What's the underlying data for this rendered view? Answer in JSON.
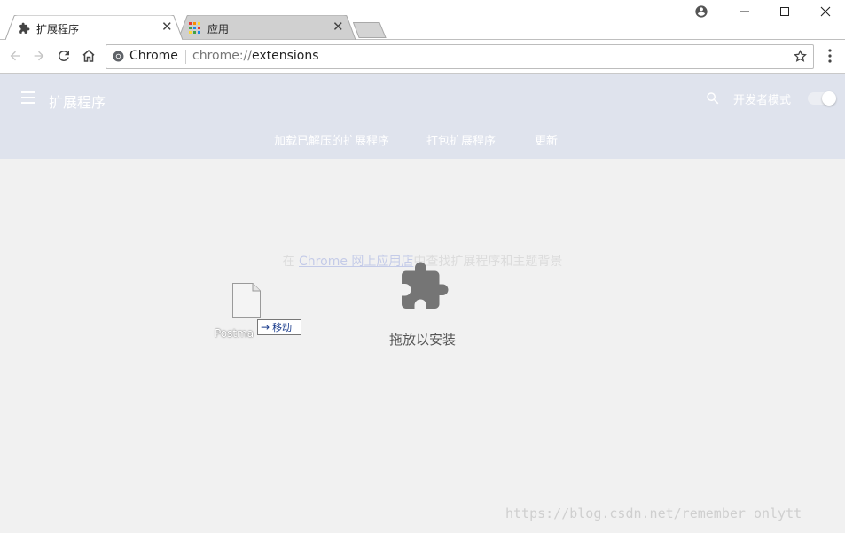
{
  "tabs": [
    {
      "title": "扩展程序",
      "favicon": "puzzle-icon",
      "active": true
    },
    {
      "title": "应用",
      "favicon": "apps-grid-icon",
      "active": false
    }
  ],
  "close_glyph": "✕",
  "window_controls": [
    "account-icon",
    "minimize-icon",
    "maximize-icon",
    "close-icon"
  ],
  "toolbar": {
    "omnibox_chrome_label": "Chrome",
    "url_scheme": "chrome://",
    "url_host": "extensions"
  },
  "extensions_page": {
    "title": "扩展程序",
    "developer_mode_label": "开发者模式",
    "developer_mode_enabled": true,
    "actions": [
      "加载已解压的扩展程序",
      "打包扩展程序",
      "更新"
    ],
    "webstore_prefix": "在 ",
    "webstore_link": "Chrome 网上应用店",
    "webstore_suffix": "中查找扩展程序和主题背景",
    "drop_to_install": "拖放以安装"
  },
  "drag_overlay": {
    "file_name": "Postma",
    "move_label": "移动",
    "arrow_glyph": "→"
  },
  "watermark": "https://blog.csdn.net/remember_onlytt",
  "colors": {
    "header_bg": "#dfe3ed",
    "page_bg": "#f1f1f1",
    "puzzle": "#757575"
  }
}
